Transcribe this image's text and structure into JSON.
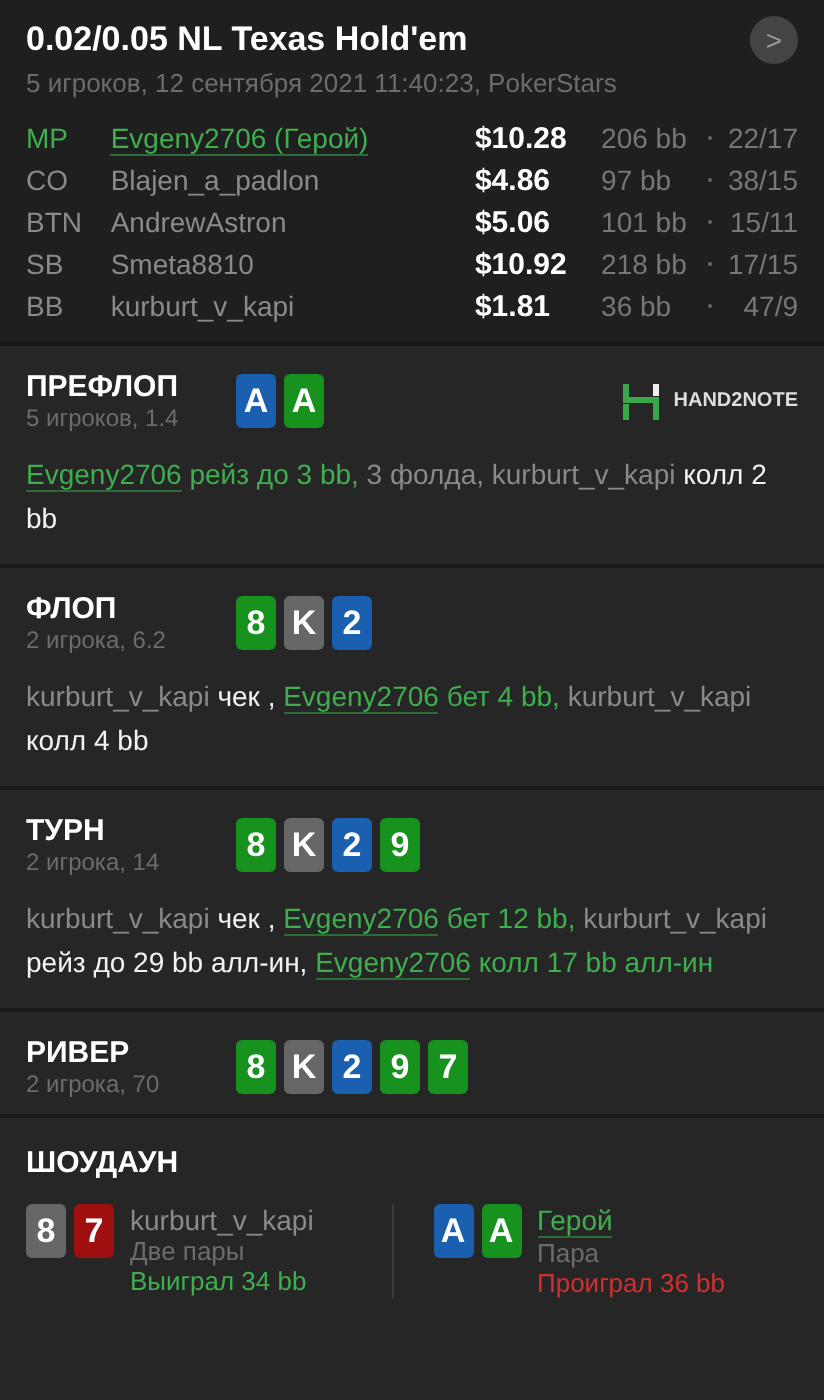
{
  "header": {
    "title": "0.02/0.05 NL Texas Hold'em",
    "subtitle": "5 игроков, 12 сентября 2021 11:40:23, PokerStars",
    "next_button": ">"
  },
  "players": [
    {
      "position": "MP",
      "name": "Evgeny2706 (Герой)",
      "hero": true,
      "stack": "$10.28",
      "bb": "206 bb",
      "stats": "22/17"
    },
    {
      "position": "CO",
      "name": "Blajen_a_padlon",
      "hero": false,
      "stack": "$4.86",
      "bb": "97 bb",
      "stats": "38/15"
    },
    {
      "position": "BTN",
      "name": "AndrewAstron",
      "hero": false,
      "stack": "$5.06",
      "bb": "101 bb",
      "stats": "15/11"
    },
    {
      "position": "SB",
      "name": "Smeta8810",
      "hero": false,
      "stack": "$10.92",
      "bb": "218 bb",
      "stats": "17/15"
    },
    {
      "position": "BB",
      "name": "kurburt_v_kapi",
      "hero": false,
      "stack": "$1.81",
      "bb": "36 bb",
      "stats": "47/9"
    }
  ],
  "streets": [
    {
      "title": "ПРЕФЛОП",
      "info": "5 игроков, 1.4",
      "logo": "HAND2NOTE",
      "cards": [
        {
          "rank": "A",
          "color": "#1a5fb0"
        },
        {
          "rank": "A",
          "color": "#17921f"
        }
      ],
      "actions": [
        {
          "kind": "hero",
          "text": "Evgeny2706"
        },
        {
          "kind": "hero-action",
          "text": " рейз до 3 bb,"
        },
        {
          "kind": "name",
          "text": " 3 фолда, kurburt_v_kapi"
        },
        {
          "kind": "action",
          "text": " колл 2 bb"
        }
      ]
    },
    {
      "title": "ФЛОП",
      "info": "2 игрока, 6.2",
      "cards": [
        {
          "rank": "8",
          "color": "#17921f"
        },
        {
          "rank": "K",
          "color": "#666666"
        },
        {
          "rank": "2",
          "color": "#1a5fb0"
        }
      ],
      "actions": [
        {
          "kind": "name",
          "text": "kurburt_v_kapi"
        },
        {
          "kind": "action",
          "text": " чек , "
        },
        {
          "kind": "hero",
          "text": "Evgeny2706"
        },
        {
          "kind": "hero-action",
          "text": " бет 4 bb,"
        },
        {
          "kind": "name",
          "text": " kurburt_v_kapi"
        },
        {
          "kind": "action",
          "text": " колл 4 bb"
        }
      ]
    },
    {
      "title": "ТУРН",
      "info": "2 игрока, 14",
      "cards": [
        {
          "rank": "8",
          "color": "#17921f"
        },
        {
          "rank": "K",
          "color": "#666666"
        },
        {
          "rank": "2",
          "color": "#1a5fb0"
        },
        {
          "rank": "9",
          "color": "#17921f"
        }
      ],
      "actions": [
        {
          "kind": "name",
          "text": "kurburt_v_kapi"
        },
        {
          "kind": "action",
          "text": " чек , "
        },
        {
          "kind": "hero",
          "text": "Evgeny2706"
        },
        {
          "kind": "hero-action",
          "text": " бет 12 bb,"
        },
        {
          "kind": "name",
          "text": " kurburt_v_kapi"
        },
        {
          "kind": "action",
          "text": " рейз до 29 bb алл-ин, "
        },
        {
          "kind": "hero",
          "text": "Evgeny2706"
        },
        {
          "kind": "hero-action",
          "text": " колл 17 bb алл-ин"
        }
      ]
    },
    {
      "title": "РИВЕР",
      "info": "2 игрока, 70",
      "cards": [
        {
          "rank": "8",
          "color": "#17921f"
        },
        {
          "rank": "K",
          "color": "#666666"
        },
        {
          "rank": "2",
          "color": "#1a5fb0"
        },
        {
          "rank": "9",
          "color": "#17921f"
        },
        {
          "rank": "7",
          "color": "#17921f"
        }
      ]
    }
  ],
  "showdown": {
    "title": "ШОУДАУН",
    "hands": [
      {
        "cards": [
          {
            "rank": "8",
            "color": "#666666"
          },
          {
            "rank": "7",
            "color": "#a00f0f"
          }
        ],
        "name": "kurburt_v_kapi",
        "hero": false,
        "combo": "Две пары",
        "result": "Выиграл 34 bb",
        "won": true
      },
      {
        "cards": [
          {
            "rank": "A",
            "color": "#1a5fb0"
          },
          {
            "rank": "A",
            "color": "#17921f"
          }
        ],
        "name": "Герой",
        "hero": true,
        "combo": "Пара",
        "result": "Проиграл 36 bb",
        "won": false
      }
    ]
  }
}
